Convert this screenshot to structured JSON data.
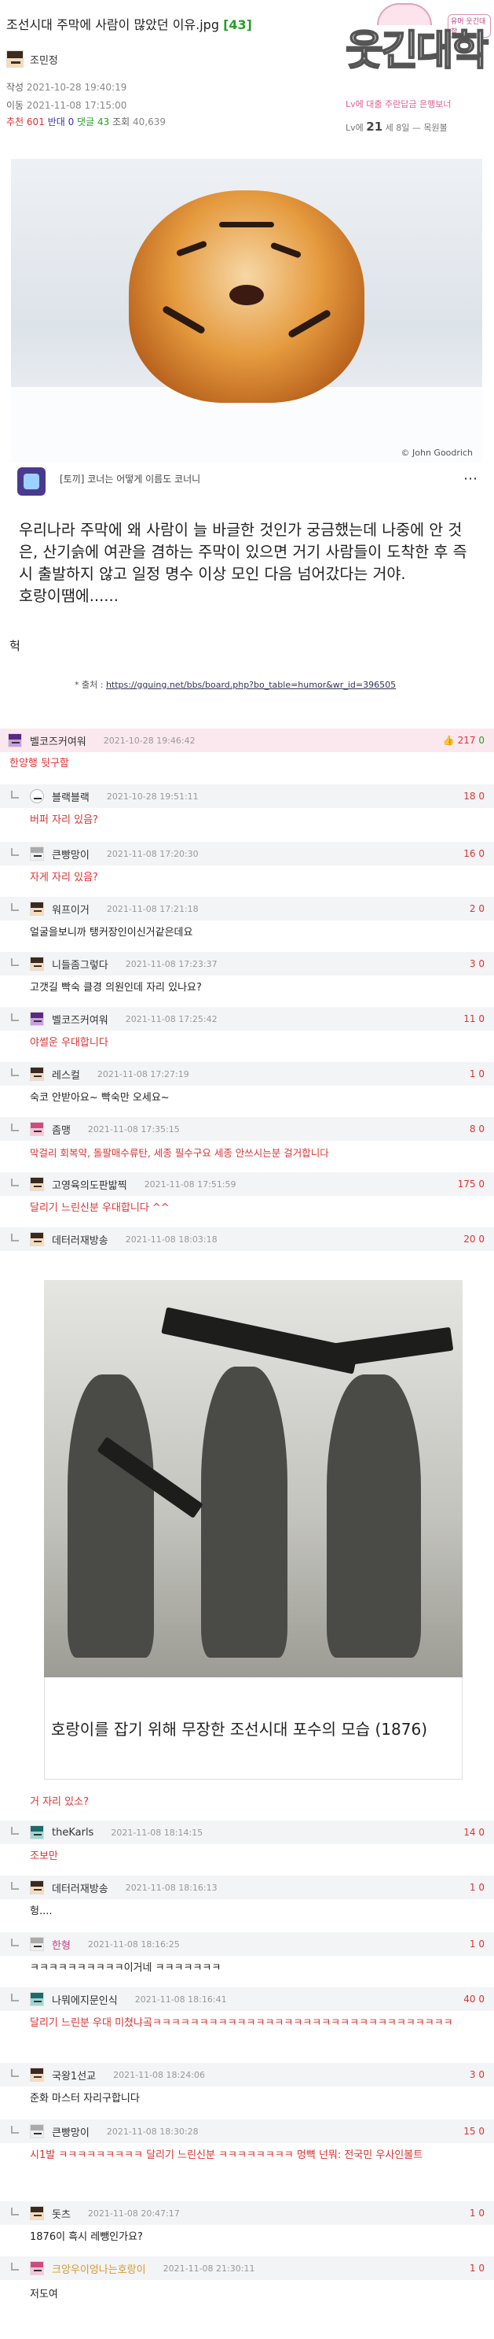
{
  "post": {
    "title": "조선시대 주막에 사람이 많았던 이유.jpg",
    "comment_count": "[43]",
    "author": "조민정",
    "meta_written_label": "작성",
    "meta_written": "2021-10-28 19:40:19",
    "meta_moved_label": "이동",
    "meta_moved": "2021-11-08 17:15:00",
    "rec_label": "추천",
    "rec": "601",
    "opp_label": "반대",
    "opp": "0",
    "reply_label": "댓글",
    "reply": "43",
    "view_label": "조회",
    "view": "40,639"
  },
  "logo": {
    "brand": "웃긴대학",
    "tag": "유머 웃긴대학",
    "line1": "Lv에 대출 주란답금 은행보너",
    "line2_prefix": "Lv에",
    "line2_big": "21",
    "line2_suffix": "세 8일 — 목원볼"
  },
  "image1": {
    "credit": "© John Goodrich"
  },
  "subheader": {
    "text": "[토끼] 코너는 어떻게 이름도 코너니"
  },
  "body": {
    "paragraph": "우리나라 주막에 왜 사람이 늘 바글한 것인가 궁금했는데 나중에 안 것은, 산기슭에 여관을 겸하는 주막이 있으면 거기 사람들이 도착한 후 즉시 출발하지 않고 일정 명수 이상 모인 다음 넘어갔다는 거야.",
    "line2": "호랑이땜에......",
    "heok": "헉",
    "source_label": "* 출처 :",
    "source_url": "https://gguing.net/bbs/board.php?bo_table=humor&wr_id=396505"
  },
  "comments": [
    {
      "nick": "벨코즈커여워",
      "time": "2021-10-28 19:46:42",
      "vote_up": "217",
      "vote_sep": "0",
      "text": "한양행 뒷구함"
    },
    {
      "nick": "블랙블랙",
      "time": "2021-10-28 19:51:11",
      "vote": "18 0",
      "text": "버퍼 자리 있음?"
    },
    {
      "nick": "큰빵망이",
      "time": "2021-11-08 17:20:30",
      "vote": "16 0",
      "text": "자게 자리 있음?"
    },
    {
      "nick": "워프이거",
      "time": "2021-11-08 17:21:18",
      "vote": "2 0",
      "text": "얼굴을보니까 탱커장인이신거같은데요"
    },
    {
      "nick": "니들좀그렇다",
      "time": "2021-11-08 17:23:37",
      "vote": "3 0",
      "text": "고갯길 빡숙 클경 의원인데 자리 있나요?"
    },
    {
      "nick": "벨코즈커여워",
      "time": "2021-11-08 17:25:42",
      "vote": "11 0",
      "text": "야썰운 우대합니다"
    },
    {
      "nick": "레스컬",
      "time": "2021-11-08 17:27:19",
      "vote": "1 0",
      "text": "숙코 안받아요~ 빡숙만 오세요~"
    },
    {
      "nick": "좀맹",
      "time": "2021-11-08 17:35:15",
      "vote": "8 0",
      "text": "막걸리 회복약, 돌팔매수류탄, 세종 필수구요 세종 안쓰시는분 걸거합니다"
    },
    {
      "nick": "고영육의도판밟찍",
      "time": "2021-11-08 17:51:59",
      "vote": "175 0",
      "text": "달리기 느린신분 우대합니다 ^^"
    },
    {
      "nick": "데터러재방송",
      "time": "2021-11-08 18:03:18",
      "vote": "20 0",
      "caption": "호랑이를 잡기 위해 무장한 조선시대 포수의 모습 (1876)",
      "text": "거 자리 있소?"
    },
    {
      "nick": "theKarls",
      "time": "2021-11-08 18:14:15",
      "vote": "14 0",
      "text": "조보만"
    },
    {
      "nick": "데터러재방송",
      "time": "2021-11-08 18:16:13",
      "vote": "1 0",
      "text": "헝...."
    },
    {
      "nick": "한형",
      "time": "2021-11-08 18:16:25",
      "vote": "1 0",
      "text": "ㅋㅋㅋㅋㅋㅋㅋㅋㅋㅋ이거네 ㅋㅋㅋㅋㅋㅋㅋ"
    },
    {
      "nick": "나뭐에지문인식",
      "time": "2021-11-08 18:16:41",
      "vote": "40 0",
      "text": "달리기 느린분 우대 미쳤냐곸ㅋㅋㅋㅋㅋㅋㅋㅋㅋㅋㅋㅋㅋㅋㅋㅋㅋㅋㅋㅋㅋㅋㅋㅋㅋㅋㅋㅋㅋㅋㅋㅋ"
    },
    {
      "nick": "국왕1선교",
      "time": "2021-11-08 18:24:06",
      "vote": "3 0",
      "text": "준화 마스터 자리구합니다"
    },
    {
      "nick": "큰빵망이",
      "time": "2021-11-08 18:30:28",
      "vote": "15 0",
      "text": "시1발 ㅋㅋㅋㅋㅋㅋㅋㅋㅋ 달리기 느린신분 ㅋㅋㅋㅋㅋㅋㅋㅋ 멍뼉 넌뭐: 전국민 우사인볼트"
    },
    {
      "nick": "돗츠",
      "time": "2021-11-08 20:47:17",
      "vote": "1 0",
      "text": "1876이 흑시 레뺑인가요?"
    },
    {
      "nick": "크앙우이엉나는호랑이",
      "time": "2021-11-08 21:30:11",
      "vote": "1 0",
      "text": "저도여"
    }
  ]
}
